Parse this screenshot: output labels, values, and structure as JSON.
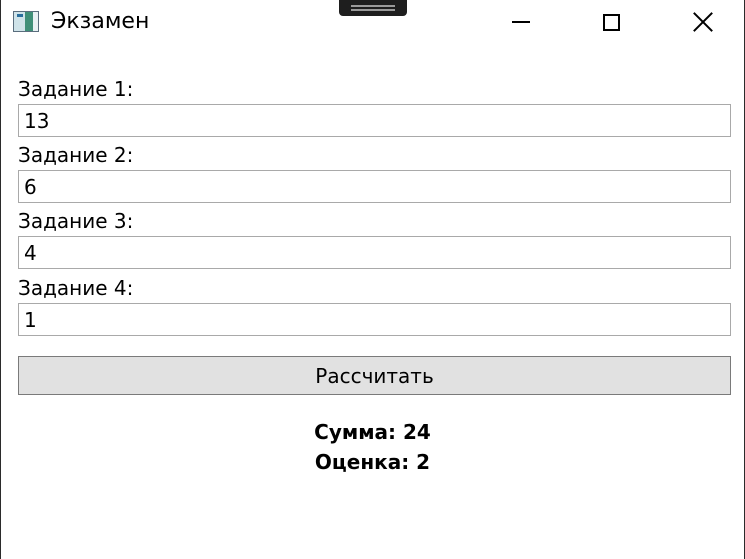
{
  "window": {
    "title": "Экзамен"
  },
  "form": {
    "tasks": [
      {
        "label": "Задание 1:",
        "value": "13"
      },
      {
        "label": "Задание 2:",
        "value": "6"
      },
      {
        "label": "Задание 3:",
        "value": "4"
      },
      {
        "label": "Задание 4:",
        "value": "1"
      }
    ],
    "calculate_label": "Рассчитать"
  },
  "results": {
    "sum": "Сумма: 24",
    "grade": "Оценка: 2"
  },
  "icons": {
    "app": "app-window-icon",
    "minimize": "minimize-icon",
    "maximize": "maximize-icon",
    "close": "close-icon"
  }
}
